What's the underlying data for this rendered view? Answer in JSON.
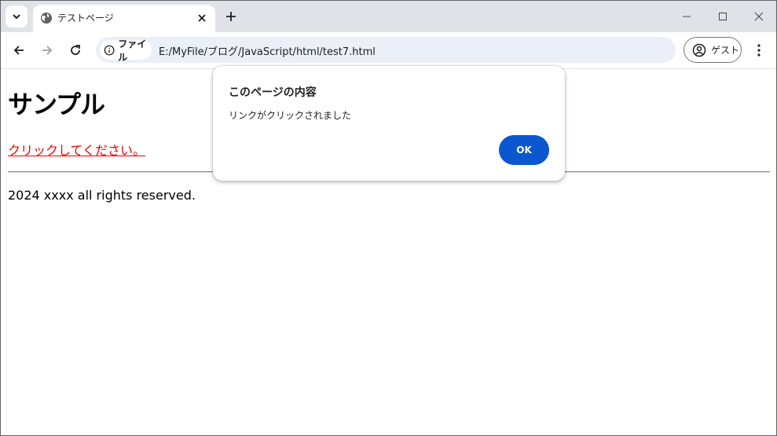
{
  "browser": {
    "tab": {
      "title": "テストページ",
      "favicon": "globe-icon"
    },
    "toolbar": {
      "back": "arrow-left-icon",
      "forward": "arrow-right-icon",
      "reload": "reload-icon",
      "omnibox": {
        "chip_label": "ファイル",
        "chip_icon": "info-icon",
        "url": "E:/MyFile/ブログ/JavaScript/html/test7.html"
      },
      "profile_label": "ゲスト",
      "menu": "more-vert-icon"
    }
  },
  "page": {
    "heading": "サンプル",
    "link": "クリックしてください。",
    "footer": "2024 xxxx all rights reserved."
  },
  "dialog": {
    "title": "このページの内容",
    "message": "リンクがクリックされました",
    "ok_label": "OK"
  },
  "colors": {
    "tabstrip_bg": "#dfe3e8",
    "omnibox_bg": "#eaeff8",
    "link": "#ee0000",
    "ok_button": "#0b57d0"
  }
}
